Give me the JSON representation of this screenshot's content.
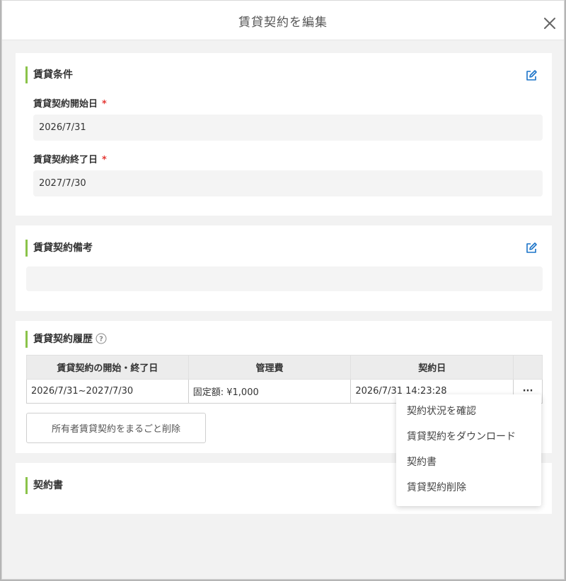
{
  "modal": {
    "title": "賃貸契約を編集",
    "close_icon": "close-icon"
  },
  "rental_conditions": {
    "title": "賃貸条件",
    "edit_icon": "edit-icon",
    "start_label": "賃貸契約開始日",
    "start_value": "2026/7/31",
    "end_label": "賃貸契約終了日",
    "end_value": "2027/7/30",
    "required_mark": "*"
  },
  "memo": {
    "title": "賃貸契約備考",
    "edit_icon": "edit-icon",
    "value": ""
  },
  "history": {
    "title": "賃貸契約履歴",
    "help_icon": "help-icon",
    "columns": [
      "賃貸契約の開始・終了日",
      "管理費",
      "契約日",
      ""
    ],
    "rows": [
      {
        "period": "2026/7/31~2027/7/30",
        "fee": "固定額: ¥1,000",
        "contract_date": "2026/7/31 14:23:28",
        "more": "···"
      }
    ],
    "delete_all_label": "所有者賃貸契約をまるごと削除"
  },
  "contract_doc": {
    "title": "契約書"
  },
  "menu": {
    "items": [
      "契約状況を確認",
      "賃貸契約をダウンロード",
      "契約書",
      "賃貸契約削除"
    ]
  },
  "colors": {
    "accent_bar": "#8bc34a",
    "edit_icon": "#1a73c8",
    "required": "#e53935"
  }
}
